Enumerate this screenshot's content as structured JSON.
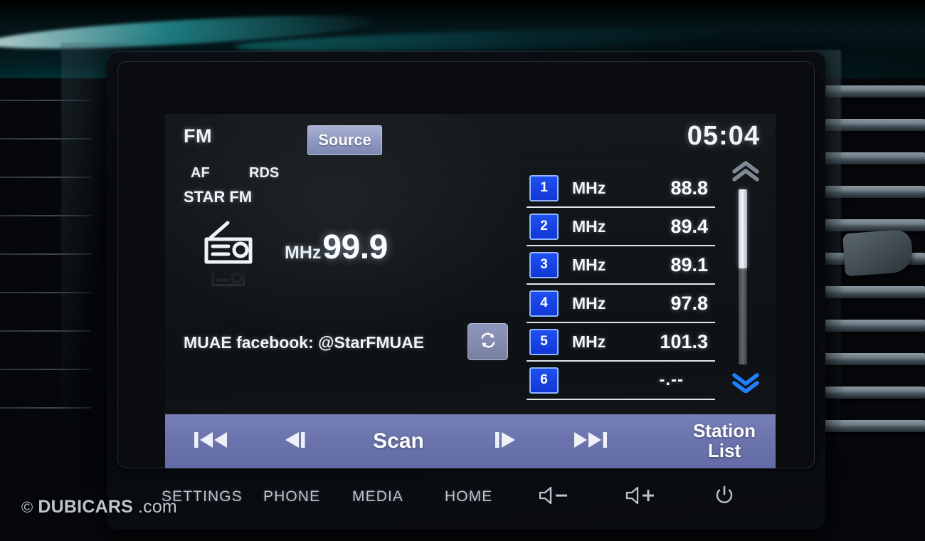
{
  "head_unit": {
    "screen": {
      "band_label": "FM",
      "source_button": "Source",
      "clock": "05:04",
      "indicators": {
        "af": "AF",
        "rds": "RDS"
      },
      "station_name": "STAR FM",
      "now_playing": {
        "frequency_unit": "MHz",
        "frequency_value": "99.9",
        "radio_icon": "radio-icon"
      },
      "radio_text": "MUAE facebook: @StarFMUAE",
      "refresh_icon": "refresh-icon",
      "presets": [
        {
          "number": "1",
          "unit": "MHz",
          "value": "88.8"
        },
        {
          "number": "2",
          "unit": "MHz",
          "value": "89.4"
        },
        {
          "number": "3",
          "unit": "MHz",
          "value": "89.1"
        },
        {
          "number": "4",
          "unit": "MHz",
          "value": "97.8"
        },
        {
          "number": "5",
          "unit": "MHz",
          "value": "101.3"
        },
        {
          "number": "6",
          "unit": "",
          "value": "-.--"
        }
      ],
      "scroll": {
        "up_icon": "chevron-up-icon",
        "down_icon": "chevron-down-icon",
        "thumb_position_percent": 0,
        "thumb_size_percent": 45
      },
      "control_bar": {
        "previous_icon": "skip-previous-icon",
        "seek_down_icon": "seek-backward-icon",
        "scan_label": "Scan",
        "seek_up_icon": "seek-forward-icon",
        "next_icon": "skip-next-icon",
        "station_list_line1": "Station",
        "station_list_line2": "List"
      }
    },
    "hardware_keys": [
      {
        "label": "SETTINGS",
        "type": "text"
      },
      {
        "label": "PHONE",
        "type": "text"
      },
      {
        "label": "MEDIA",
        "type": "text"
      },
      {
        "label": "HOME",
        "type": "text"
      },
      {
        "label": "",
        "type": "volume-down-icon"
      },
      {
        "label": "",
        "type": "volume-up-icon"
      },
      {
        "label": "",
        "type": "power-icon"
      }
    ]
  },
  "watermark": {
    "copyright": "©",
    "brand": "DUBICARS",
    "suffix": ".com"
  },
  "colors": {
    "preset_badge_blue": "#1540e8",
    "control_bar_purple": "#6b74ad",
    "source_button": "#8e97bf",
    "screen_background": "#121518",
    "scroll_down_active": "#1f7fff",
    "text_primary": "#f2f5f8"
  }
}
